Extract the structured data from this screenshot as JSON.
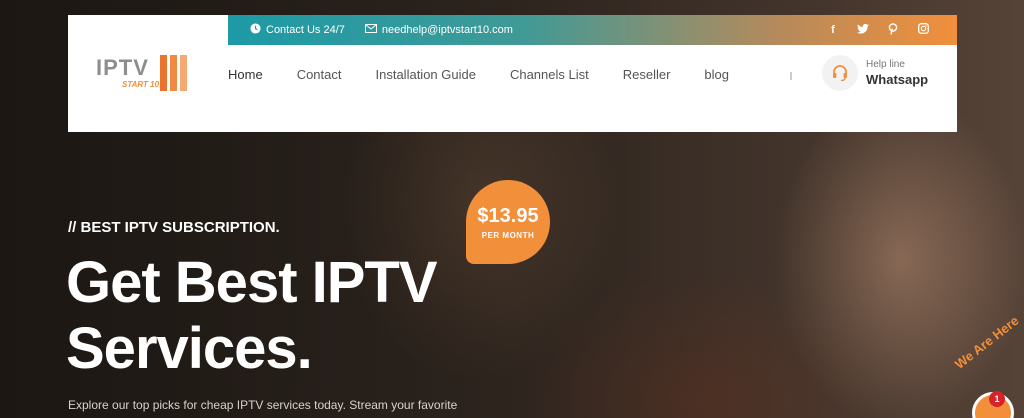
{
  "topbar": {
    "contact_label": "Contact Us 24/7",
    "email_label": "needhelp@iptvstart10.com",
    "socials": [
      "f",
      "t",
      "p",
      "ig"
    ]
  },
  "logo": {
    "word": "IPTV",
    "sub": "START 10"
  },
  "nav": {
    "items": [
      "Home",
      "Contact",
      "Installation Guide",
      "Channels List",
      "Reseller",
      "blog"
    ]
  },
  "helpline": {
    "label": "Help line",
    "value": "Whatsapp"
  },
  "hero": {
    "kicker": "// BEST IPTV SUBSCRIPTION.",
    "headline_line1": "Get Best IPTV",
    "headline_line2": "Services.",
    "description": "Explore our top picks for cheap IPTV services today. Stream your favorite"
  },
  "price_badge": {
    "amount": "$13.95",
    "period": "PER MONTH"
  },
  "chat": {
    "label": "We Are Here",
    "count": "1"
  },
  "colors": {
    "accent": "#f28f3b",
    "teal": "#1d9aa6",
    "badge_red": "#d6232a"
  }
}
